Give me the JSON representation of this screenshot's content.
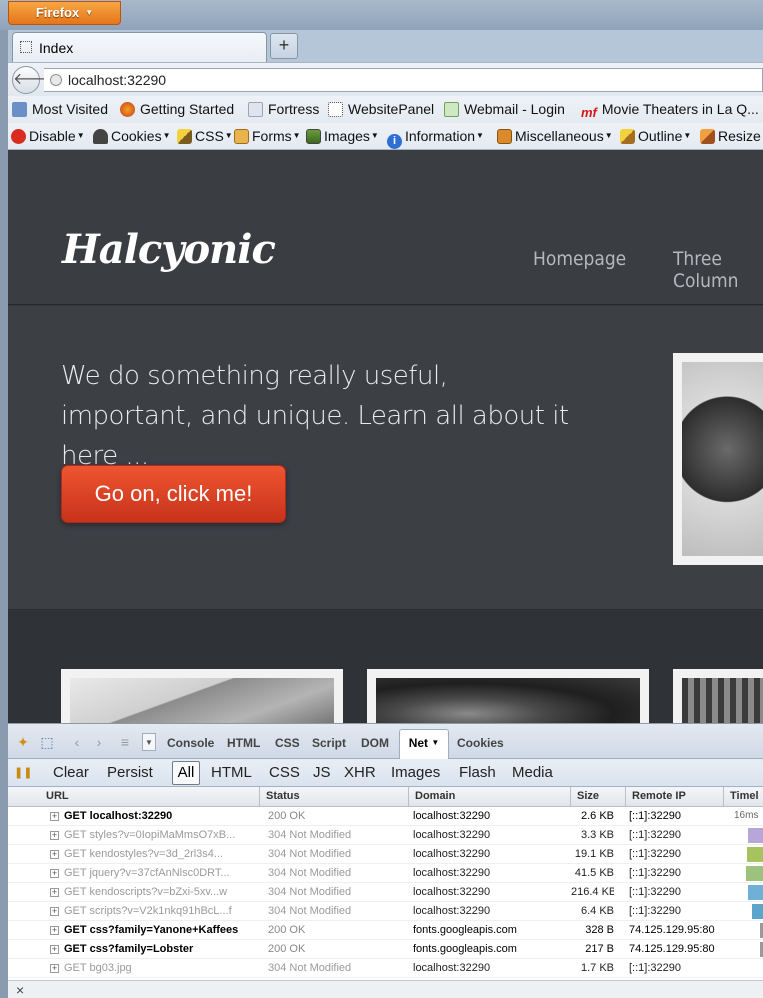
{
  "browser": {
    "menu_button": "Firefox",
    "tab_title": "Index",
    "new_tab": "+",
    "url": "localhost:32290",
    "bookmarks": [
      "Most Visited",
      "Getting Started",
      "Fortress",
      "WebsitePanel",
      "Webmail - Login",
      "Movie Theaters in La Q..."
    ],
    "devtools": [
      "Disable",
      "Cookies",
      "CSS",
      "Forms",
      "Images",
      "Information",
      "Miscellaneous",
      "Outline",
      "Resize"
    ]
  },
  "site": {
    "logo": "Halcyonic",
    "nav": [
      "Homepage",
      "Three Column"
    ],
    "tagline": "We do something really useful, important, and unique. Learn all about it here ...",
    "cta": "Go on, click me!"
  },
  "firebug": {
    "tabs": [
      "Console",
      "HTML",
      "CSS",
      "Script",
      "DOM",
      "Net",
      "Cookies"
    ],
    "filters": [
      "Clear",
      "Persist",
      "All",
      "HTML",
      "CSS",
      "JS",
      "XHR",
      "Images",
      "Flash",
      "Media"
    ],
    "columns": [
      "URL",
      "Status",
      "Domain",
      "Size",
      "Remote IP",
      "Timel"
    ],
    "rows": [
      {
        "url": "GET localhost:32290",
        "status": "200 OK",
        "domain": "localhost:32290",
        "size": "2.6 KB",
        "ip": "[::1]:32290",
        "time": "16ms",
        "state": "ok"
      },
      {
        "url": "GET styles?v=0IopiMaMmsO7xB...",
        "status": "304 Not Modified",
        "domain": "localhost:32290",
        "size": "3.3 KB",
        "ip": "[::1]:32290",
        "time": "",
        "state": "cached"
      },
      {
        "url": "GET kendostyles?v=3d_2rl3s4...",
        "status": "304 Not Modified",
        "domain": "localhost:32290",
        "size": "19.1 KB",
        "ip": "[::1]:32290",
        "time": "",
        "state": "cached"
      },
      {
        "url": "GET jquery?v=37cfAnNlsc0DRT...",
        "status": "304 Not Modified",
        "domain": "localhost:32290",
        "size": "41.5 KB",
        "ip": "[::1]:32290",
        "time": "",
        "state": "cached"
      },
      {
        "url": "GET kendoscripts?v=bZxi-5xv...w",
        "status": "304 Not Modified",
        "domain": "localhost:32290",
        "size": "216.4 KB",
        "ip": "[::1]:32290",
        "time": "",
        "state": "cached"
      },
      {
        "url": "GET scripts?v=V2k1nkq91hBcL...f",
        "status": "304 Not Modified",
        "domain": "localhost:32290",
        "size": "6.4 KB",
        "ip": "[::1]:32290",
        "time": "",
        "state": "cached"
      },
      {
        "url": "GET css?family=Yanone+Kaffees",
        "status": "200 OK",
        "domain": "fonts.googleapis.com",
        "size": "328 B",
        "ip": "74.125.129.95:80",
        "time": "",
        "state": "ok"
      },
      {
        "url": "GET css?family=Lobster",
        "status": "200 OK",
        "domain": "fonts.googleapis.com",
        "size": "217 B",
        "ip": "74.125.129.95:80",
        "time": "",
        "state": "ok"
      },
      {
        "url": "GET bg03.jpg",
        "status": "304 Not Modified",
        "domain": "localhost:32290",
        "size": "1.7 KB",
        "ip": "[::1]:32290",
        "time": "",
        "state": "cached"
      }
    ],
    "close": "×"
  },
  "colors": {
    "cta": "#d63f22",
    "header_bg": "#3a3d41",
    "firefox_button": "#e87f22"
  }
}
